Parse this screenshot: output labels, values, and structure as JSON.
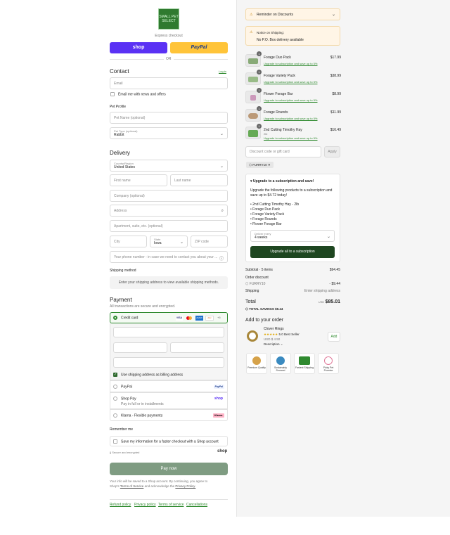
{
  "checkout": {
    "logo_text": "SMALL PET SELECT",
    "express_label": "Express checkout",
    "shop_pay_label": "shop",
    "paypal_label": "PayPal",
    "or_label": "OR"
  },
  "contact": {
    "title": "Contact",
    "login_link": "Log in",
    "email_placeholder": "Email",
    "email_news_label": "Email me with news and offers"
  },
  "pet_profile": {
    "title": "Pet Profile",
    "pet_name_placeholder": "Pet Name (optional)",
    "pet_type_label": "Pet Type (optional)",
    "pet_type_value": "Rabbit"
  },
  "delivery": {
    "title": "Delivery",
    "country_label": "Country/Region",
    "country_value": "United States",
    "first_name": "First name",
    "last_name": "Last name",
    "company": "Company (optional)",
    "address": "Address",
    "apartment": "Apartment, suite, etc. (optional)",
    "city": "City",
    "state_label": "State",
    "state_value": "Iowa",
    "zip": "ZIP code",
    "phone": "Your phone number - in case we need to contact you about your ..."
  },
  "shipping": {
    "title": "Shipping method",
    "message": "Enter your shipping address to view available shipping methods."
  },
  "payment": {
    "title": "Payment",
    "subtitle": "All transactions are secure and encrypted.",
    "credit_card": "Credit card",
    "card_more": "+6",
    "billing_same": "Use shipping address as billing address",
    "paypal": "PayPal",
    "shop_pay": "Shop Pay",
    "shop_pay_sub": "Pay in full or in installments",
    "klarna": "Klarna - Flexible payments",
    "klarna_badge": "Klarna."
  },
  "remember": {
    "title": "Remember me",
    "save_info": "Save my information for a faster checkout with a Shop account",
    "secure": "Secure and encrypted",
    "shop": "shop"
  },
  "pay_now": "Pay now",
  "legal": {
    "line1": "Your info will be saved to a Shop account. By continuing, you agree to",
    "line2a": "Shop's",
    "terms": "Terms of Service",
    "line2b": "and acknowledge the",
    "privacy": "Privacy Policy."
  },
  "footer_links": [
    "Refund policy",
    "Privacy policy",
    "Terms of service",
    "Cancellations"
  ],
  "summary": {
    "reminder": "Reminder on Discounts",
    "notice_title": "Notice on Shipping:",
    "notice_text": "No P.O. Box delivery available",
    "items": [
      {
        "name": "Forage Duo Pack",
        "price": "$17.99",
        "qty": "1",
        "upgrade": "Upgrade to subscription and save up to 5%"
      },
      {
        "name": "Forage Variety Pack",
        "price": "$38.99",
        "qty": "1",
        "upgrade": "Upgrade to subscription and save up to 5%"
      },
      {
        "name": "Flower Forage Bar",
        "price": "$8.99",
        "qty": "1",
        "upgrade": "Upgrade to subscription and save up to 5%"
      },
      {
        "name": "Forage Rounds",
        "price": "$11.99",
        "qty": "1",
        "upgrade": "Upgrade to subscription and save up to 5%"
      },
      {
        "name": "2nd Cutting Timothy Hay",
        "sub": "2lb",
        "price": "$16.49",
        "qty": "1",
        "upgrade": "Upgrade to subscription and save up to 5%"
      }
    ],
    "discount_placeholder": "Discount code or gift card",
    "apply": "Apply",
    "code_tag": "FURRY10",
    "upsell_title": "Upgrade to a subscription and save!",
    "upsell_text": "Upgrade the following products to a subscription and save up to $4.72 today!",
    "upsell_items": [
      "2nd Cutting Timothy Hay - 2lb",
      "Forage Duo Pack",
      "Forage Variety Pack",
      "Forage Rounds",
      "Flower Forage Bar"
    ],
    "deliver_label": "Deliver every",
    "deliver_value": "4 weeks",
    "upsell_button": "Upgrade all to a subscription",
    "subtotal_label": "Subtotal · 5 items",
    "subtotal": "$94.45",
    "order_discount": "Order discount",
    "discount_code": "FURRY10",
    "discount_amount": "- $9.44",
    "shipping_label": "Shipping",
    "shipping_value": "Enter shipping address",
    "total_label": "Total",
    "currency": "USD",
    "total": "$85.01",
    "savings_label": "TOTAL SAVINGS",
    "savings": "$9.44",
    "add_title": "Add to your order",
    "addon_name": "Clover Rings",
    "addon_rating": "5.0",
    "addon_badge": "Best Seller",
    "addon_price": "USD $ 4.50",
    "addon_desc": "Description",
    "addon_button": "Add",
    "badges": [
      "Premium Quality",
      "Sustainably Sourced",
      "Fastest Shipping",
      "Picky Pet Promise"
    ]
  },
  "colors": {
    "accent": "#2f8a2f",
    "shop_pay": "#5a31f4",
    "paypal": "#ffc439",
    "pay_button": "#7f9c82",
    "upsell_button": "#1e4620"
  }
}
